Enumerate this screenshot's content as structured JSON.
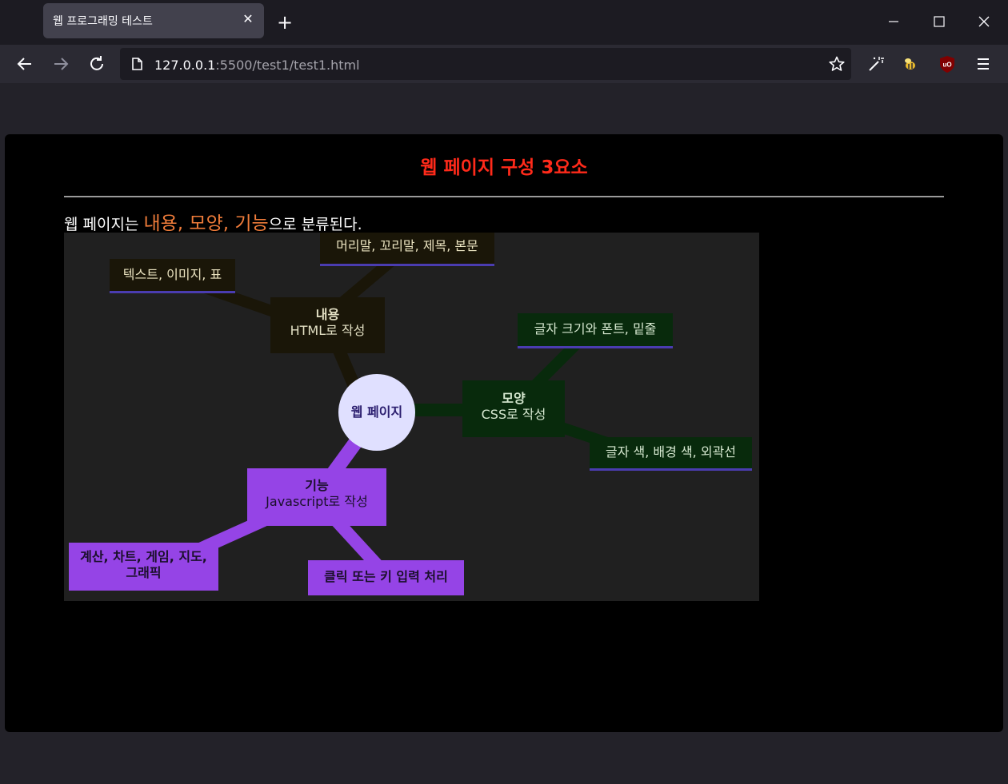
{
  "browser": {
    "tab": {
      "title": "웹 프로그래밍 테스트",
      "close": "✕"
    },
    "new_tab": "+",
    "url": {
      "host": "127.0.0.1",
      "rest": ":5500/test1/test1.html"
    }
  },
  "page": {
    "title": "웹 페이지 구성 3요소",
    "intro": {
      "prefix": "웹 페이지는 ",
      "highlight": "내용, 모양, 기능",
      "suffix": "으로 분류된다."
    }
  },
  "mindmap": {
    "center": "웹 페이지",
    "content": {
      "title": "내용",
      "subtitle": "HTML로 작성"
    },
    "content_leaves": [
      "텍스트, 이미지, 표",
      "머리말, 꼬리말, 제목, 본문"
    ],
    "style": {
      "title": "모양",
      "subtitle": "CSS로 작성"
    },
    "style_leaves": [
      "글자 크기와 폰트, 밑줄",
      "글자 색, 배경 색, 외곽선"
    ],
    "function": {
      "title": "기능",
      "subtitle": "Javascript로 작성"
    },
    "function_leaves": [
      "계산, 차트, 게임, 지도,",
      "그래픽",
      "클릭 또는 키 입력 처리"
    ]
  },
  "colors": {
    "title": "#ff2a1a",
    "highlight": "#f07c3a",
    "content_branch": "#1a1608",
    "style_branch": "#082a0c",
    "function_branch": "#9544e6",
    "center": "#e0e0ff"
  }
}
